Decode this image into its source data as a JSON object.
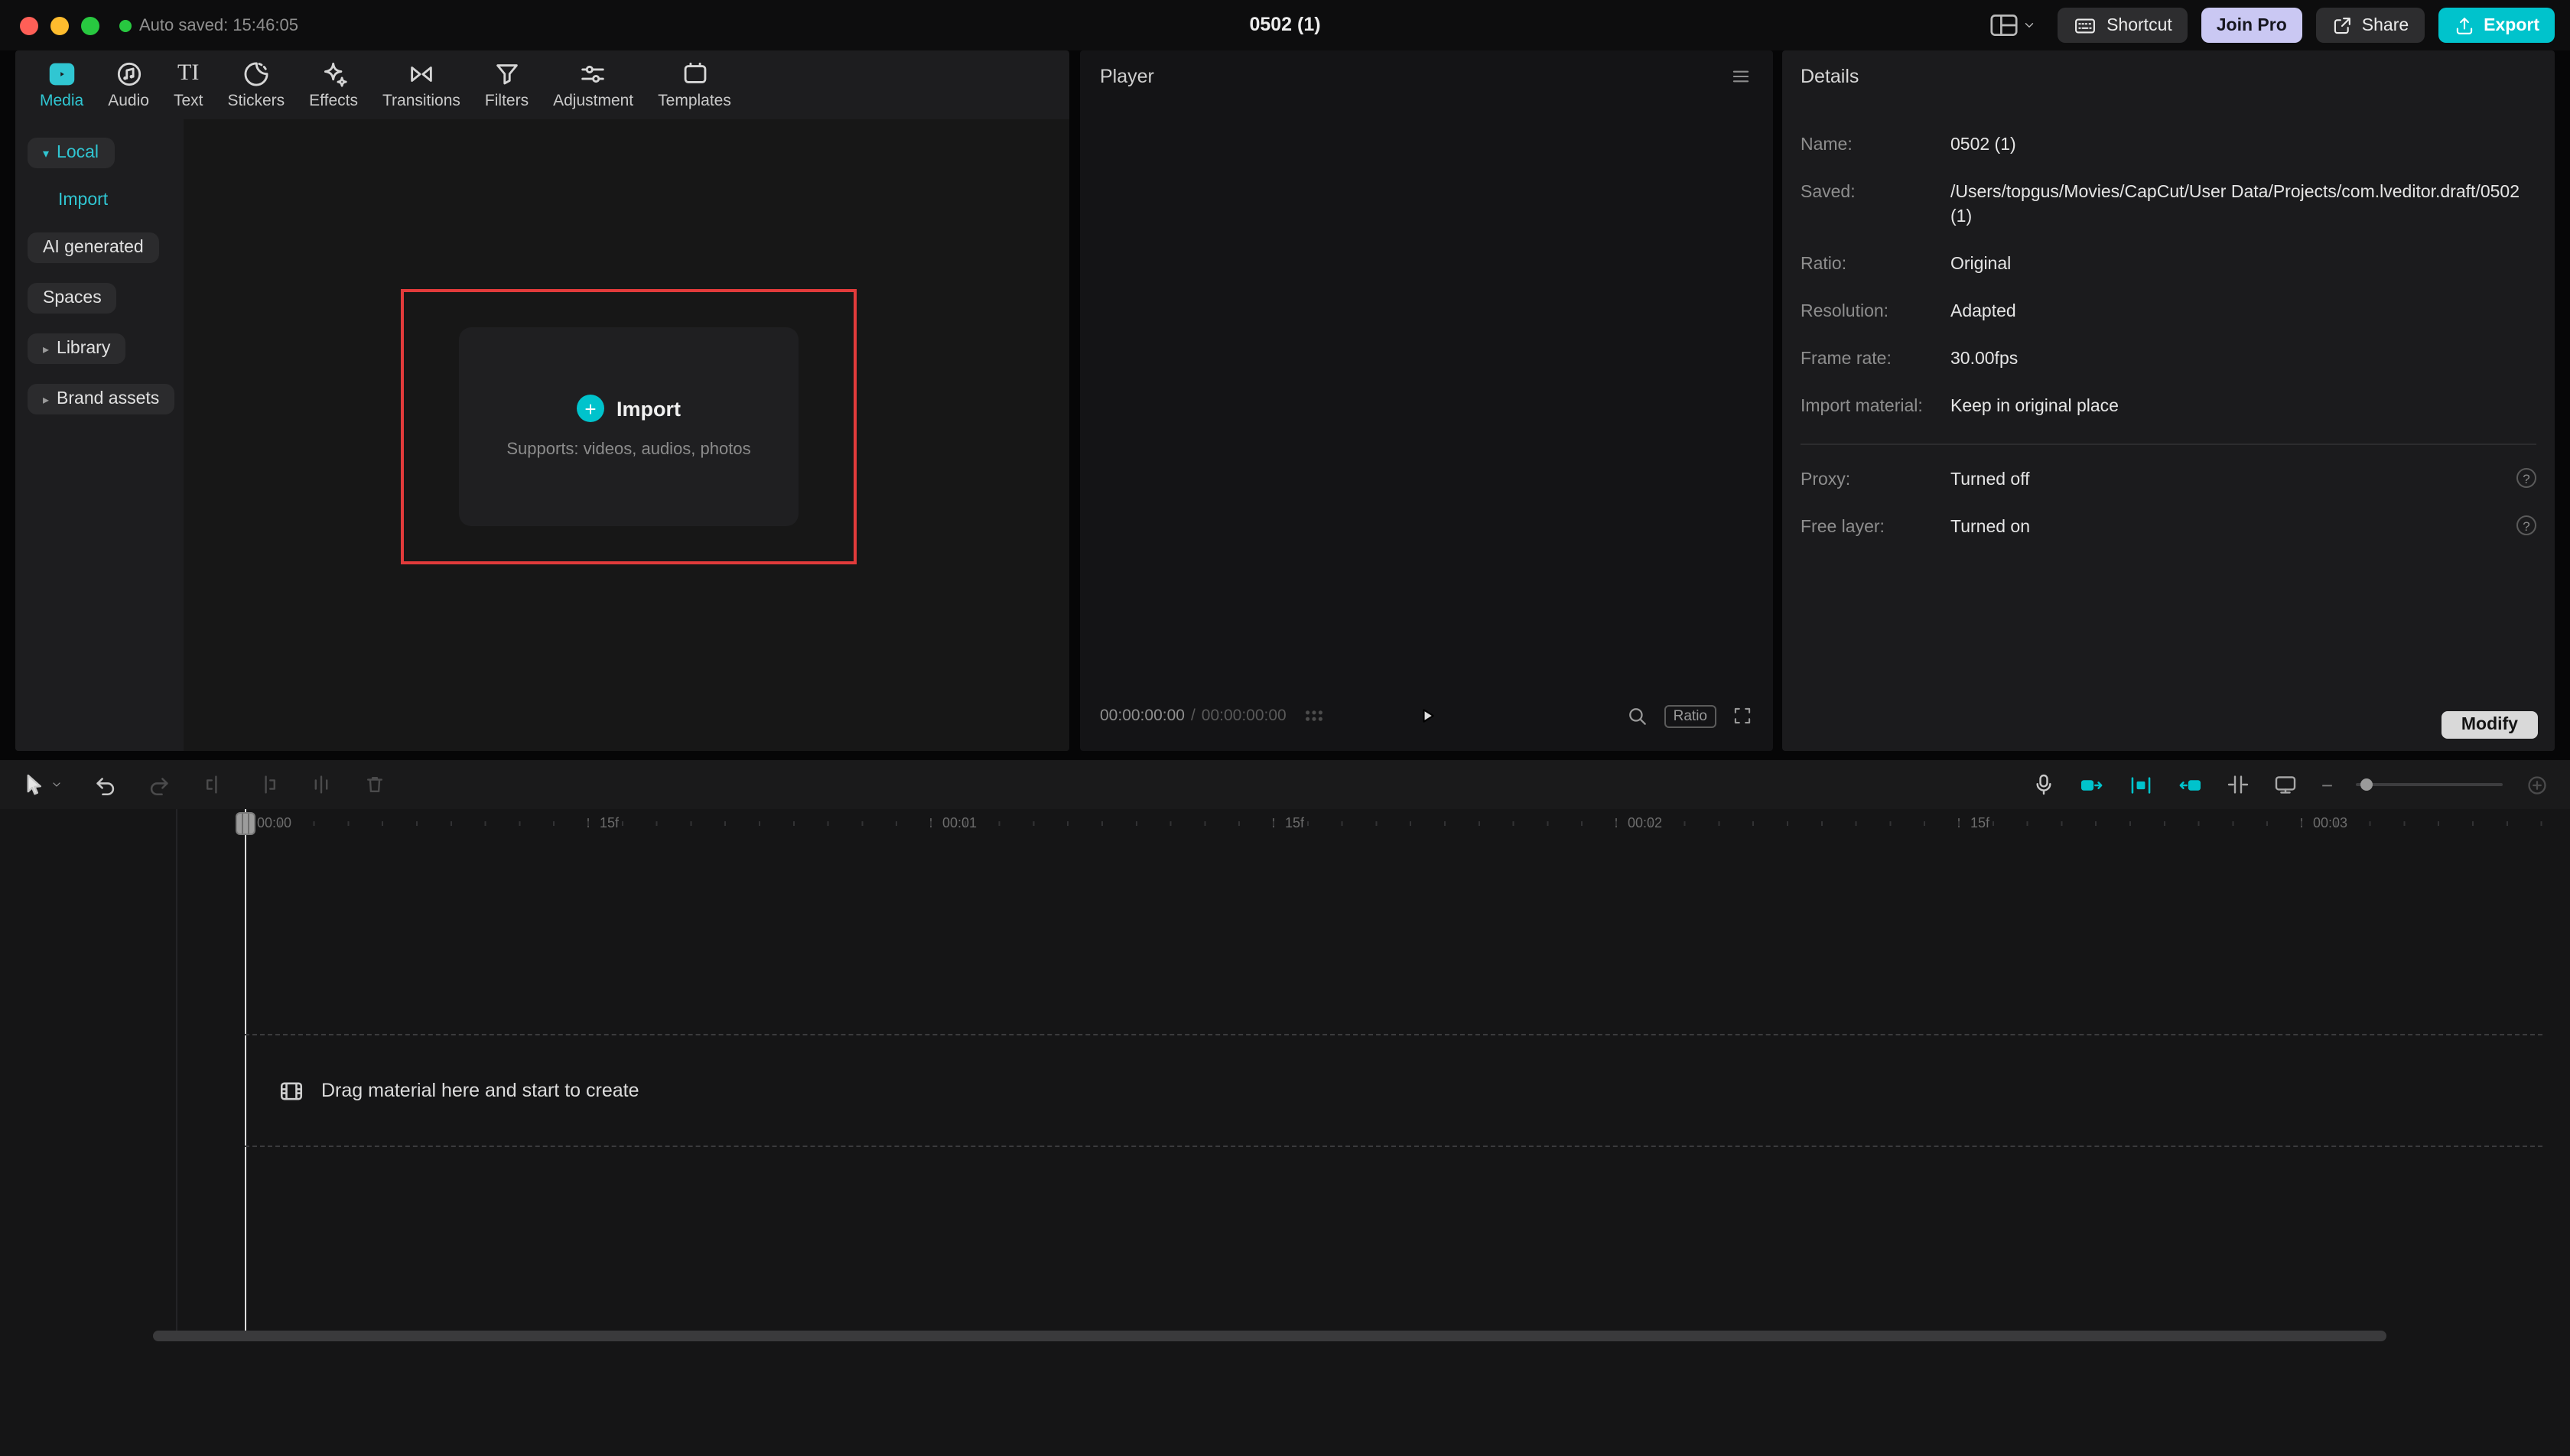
{
  "colors": {
    "accent": "#00c3cc",
    "accent-text": "#30c6d2",
    "pro": "#cac8f3",
    "red-highlight": "#e23b3b",
    "traffic-red": "#ff5f57",
    "traffic-yellow": "#febc2e",
    "traffic-green": "#28c840"
  },
  "glyphs": {
    "plus": "+",
    "minus": "−",
    "question": "?",
    "caret_down": "▾",
    "caret_right": "▸",
    "text_tool": "TI"
  },
  "titlebar": {
    "autosave": "Auto saved: 15:46:05",
    "title": "0502 (1)",
    "shortcut_label": "Shortcut",
    "join_pro_label": "Join Pro",
    "share_label": "Share",
    "export_label": "Export"
  },
  "media_panel": {
    "tabs": [
      {
        "label": "Media"
      },
      {
        "label": "Audio"
      },
      {
        "label": "Text"
      },
      {
        "label": "Stickers"
      },
      {
        "label": "Effects"
      },
      {
        "label": "Transitions"
      },
      {
        "label": "Filters"
      },
      {
        "label": "Adjustment"
      },
      {
        "label": "Templates"
      }
    ],
    "sidebar": {
      "local": "Local",
      "import": "Import",
      "ai_generated": "AI generated",
      "spaces": "Spaces",
      "library": "Library",
      "brand_assets": "Brand assets"
    },
    "import_box": {
      "button_label": "Import",
      "hint": "Supports: videos, audios, photos"
    }
  },
  "player": {
    "title": "Player",
    "current_time": "00:00:00:00",
    "separator": "/",
    "duration": "00:00:00:00",
    "ratio_label": "Ratio"
  },
  "details": {
    "title": "Details",
    "rows": [
      {
        "label": "Name:",
        "value": "0502 (1)"
      },
      {
        "label": "Saved:",
        "value": "/Users/topgus/Movies/CapCut/User Data/Projects/com.lveditor.draft/0502 (1)"
      },
      {
        "label": "Ratio:",
        "value": "Original"
      },
      {
        "label": "Resolution:",
        "value": "Adapted"
      },
      {
        "label": "Frame rate:",
        "value": "30.00fps"
      },
      {
        "label": "Import material:",
        "value": "Keep in original place"
      }
    ],
    "toggles": [
      {
        "label": "Proxy:",
        "value": "Turned off"
      },
      {
        "label": "Free layer:",
        "value": "Turned on"
      }
    ],
    "modify_label": "Modify"
  },
  "timeline": {
    "ruler": [
      "00:00",
      "15f",
      "00:01",
      "15f",
      "00:02",
      "15f",
      "00:03"
    ],
    "dropzone_hint": "Drag material here and start to create"
  }
}
